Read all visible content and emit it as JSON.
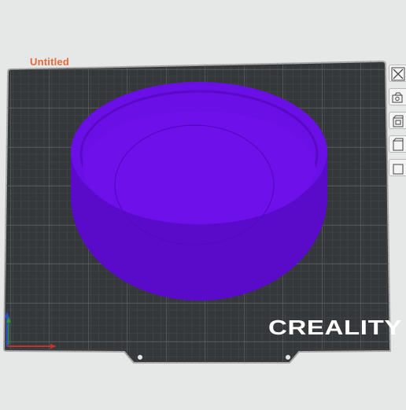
{
  "project": {
    "title": "Untitled"
  },
  "bed": {
    "brand": "CREALITY"
  },
  "model": {
    "color": "#6a0fe8",
    "shape": "round-tray"
  },
  "toolbar": {
    "buttons": [
      {
        "name": "close-view-icon"
      },
      {
        "name": "camera-view-icon"
      },
      {
        "name": "object-box-icon"
      },
      {
        "name": "box-icon"
      },
      {
        "name": "more-icon"
      }
    ]
  },
  "axis_gizmo": {
    "x_color": "#c2342b",
    "y_color": "#2b8f3a",
    "z_color": "#2c4fd3"
  }
}
